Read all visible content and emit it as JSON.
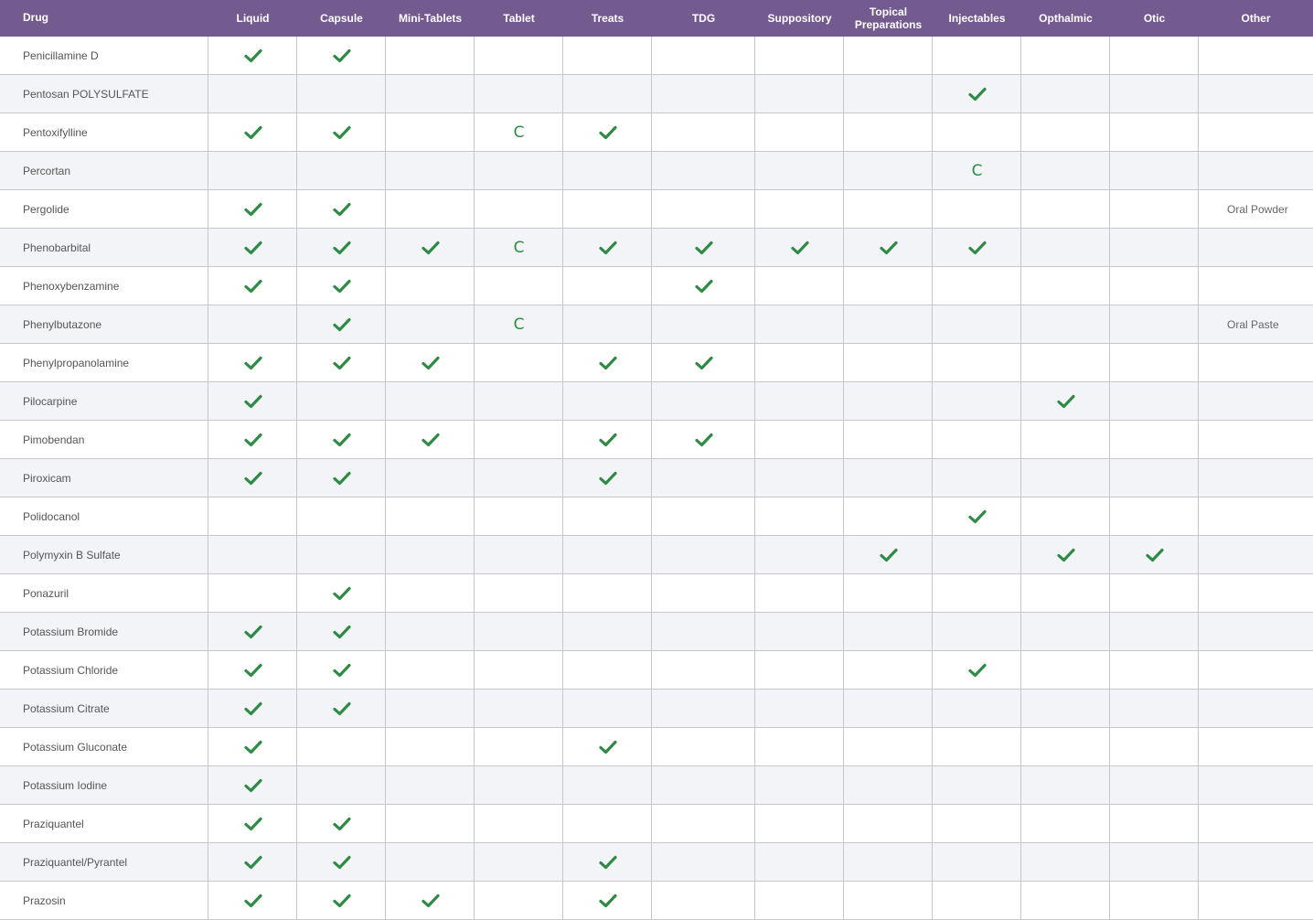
{
  "table": {
    "columns": [
      "Drug",
      "Liquid",
      "Capsule",
      "Mini-Tablets",
      "Tablet",
      "Treats",
      "TDG",
      "Suppository",
      "Topical\nPreparations",
      "Injectables",
      "Opthalmic",
      "Otic",
      "Other"
    ],
    "rows": [
      {
        "drug": "Penicillamine D",
        "marks": [
          "check",
          "check",
          "",
          "",
          "",
          "",
          "",
          "",
          "",
          "",
          "",
          ""
        ]
      },
      {
        "drug": "Pentosan POLYSULFATE",
        "marks": [
          "",
          "",
          "",
          "",
          "",
          "",
          "",
          "",
          "check",
          "",
          "",
          ""
        ]
      },
      {
        "drug": "Pentoxifylline",
        "marks": [
          "check",
          "check",
          "",
          "C",
          "check",
          "",
          "",
          "",
          "",
          "",
          "",
          ""
        ]
      },
      {
        "drug": "Percortan",
        "marks": [
          "",
          "",
          "",
          "",
          "",
          "",
          "",
          "",
          "C",
          "",
          "",
          ""
        ]
      },
      {
        "drug": "Pergolide",
        "marks": [
          "check",
          "check",
          "",
          "",
          "",
          "",
          "",
          "",
          "",
          "",
          "",
          "Oral Powder"
        ]
      },
      {
        "drug": "Phenobarbital",
        "marks": [
          "check",
          "check",
          "check",
          "C",
          "check",
          "check",
          "check",
          "check",
          "check",
          "",
          "",
          ""
        ]
      },
      {
        "drug": "Phenoxybenzamine",
        "marks": [
          "check",
          "check",
          "",
          "",
          "",
          "check",
          "",
          "",
          "",
          "",
          "",
          ""
        ]
      },
      {
        "drug": "Phenylbutazone",
        "marks": [
          "",
          "check",
          "",
          "C",
          "",
          "",
          "",
          "",
          "",
          "",
          "",
          "Oral Paste"
        ]
      },
      {
        "drug": "Phenylpropanolamine",
        "marks": [
          "check",
          "check",
          "check",
          "",
          "check",
          "check",
          "",
          "",
          "",
          "",
          "",
          ""
        ]
      },
      {
        "drug": "Pilocarpine",
        "marks": [
          "check",
          "",
          "",
          "",
          "",
          "",
          "",
          "",
          "",
          "check",
          "",
          ""
        ]
      },
      {
        "drug": "Pimobendan",
        "marks": [
          "check",
          "check",
          "check",
          "",
          "check",
          "check",
          "",
          "",
          "",
          "",
          "",
          ""
        ]
      },
      {
        "drug": "Piroxicam",
        "marks": [
          "check",
          "check",
          "",
          "",
          "check",
          "",
          "",
          "",
          "",
          "",
          "",
          ""
        ]
      },
      {
        "drug": "Polidocanol",
        "marks": [
          "",
          "",
          "",
          "",
          "",
          "",
          "",
          "",
          "check",
          "",
          "",
          ""
        ]
      },
      {
        "drug": "Polymyxin B Sulfate",
        "marks": [
          "",
          "",
          "",
          "",
          "",
          "",
          "",
          "check",
          "",
          "check",
          "check",
          ""
        ]
      },
      {
        "drug": "Ponazuril",
        "marks": [
          "",
          "check",
          "",
          "",
          "",
          "",
          "",
          "",
          "",
          "",
          "",
          ""
        ]
      },
      {
        "drug": "Potassium Bromide",
        "marks": [
          "check",
          "check",
          "",
          "",
          "",
          "",
          "",
          "",
          "",
          "",
          "",
          ""
        ]
      },
      {
        "drug": "Potassium Chloride",
        "marks": [
          "check",
          "check",
          "",
          "",
          "",
          "",
          "",
          "",
          "check",
          "",
          "",
          ""
        ]
      },
      {
        "drug": "Potassium Citrate",
        "marks": [
          "check",
          "check",
          "",
          "",
          "",
          "",
          "",
          "",
          "",
          "",
          "",
          ""
        ]
      },
      {
        "drug": "Potassium Gluconate",
        "marks": [
          "check",
          "",
          "",
          "",
          "check",
          "",
          "",
          "",
          "",
          "",
          "",
          ""
        ]
      },
      {
        "drug": "Potassium Iodine",
        "marks": [
          "check",
          "",
          "",
          "",
          "",
          "",
          "",
          "",
          "",
          "",
          "",
          ""
        ]
      },
      {
        "drug": "Praziquantel",
        "marks": [
          "check",
          "check",
          "",
          "",
          "",
          "",
          "",
          "",
          "",
          "",
          "",
          ""
        ]
      },
      {
        "drug": "Praziquantel/Pyrantel",
        "marks": [
          "check",
          "check",
          "",
          "",
          "check",
          "",
          "",
          "",
          "",
          "",
          "",
          ""
        ]
      },
      {
        "drug": "Prazosin",
        "marks": [
          "check",
          "check",
          "check",
          "",
          "check",
          "",
          "",
          "",
          "",
          "",
          "",
          ""
        ]
      }
    ]
  },
  "colors": {
    "header_bg": "#735b8f",
    "check": "#2f8a45",
    "row_alt": "#f3f4f7",
    "grid_line": "#c7c7c7"
  }
}
